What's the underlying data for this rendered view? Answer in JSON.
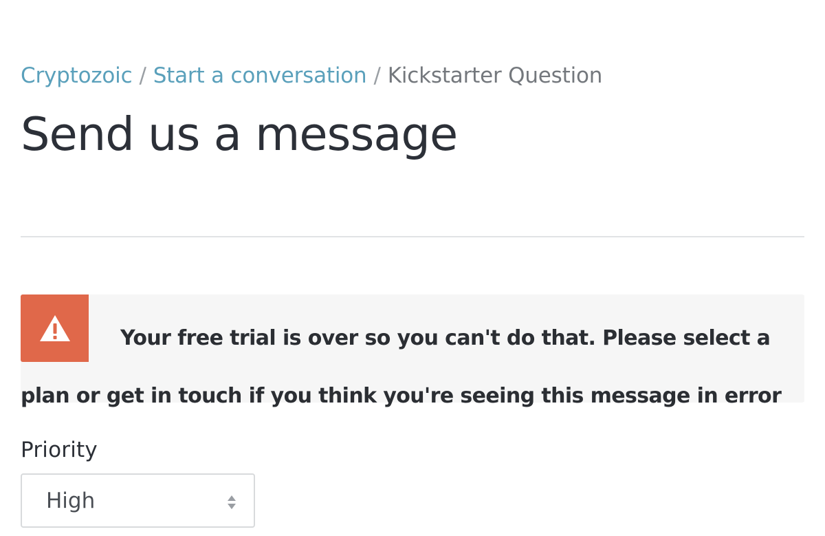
{
  "breadcrumb": {
    "items": [
      {
        "label": "Cryptozoic"
      },
      {
        "label": "Start a conversation"
      },
      {
        "label": "Kickstarter Question"
      }
    ],
    "separator": "/"
  },
  "page": {
    "title": "Send us a message"
  },
  "alert": {
    "icon": "warning-triangle-icon",
    "message": "Your free trial is over so you can't do that. Please select a plan or get in touch if you think you're seeing this message in error",
    "accent_color": "#e0684a",
    "background_color": "#f6f6f6"
  },
  "form": {
    "priority": {
      "label": "Priority",
      "selected": "High",
      "icon": "select-arrows-icon"
    }
  },
  "colors": {
    "link": "#5aa0bb",
    "text": "#2b2f36",
    "muted": "#74787d"
  }
}
